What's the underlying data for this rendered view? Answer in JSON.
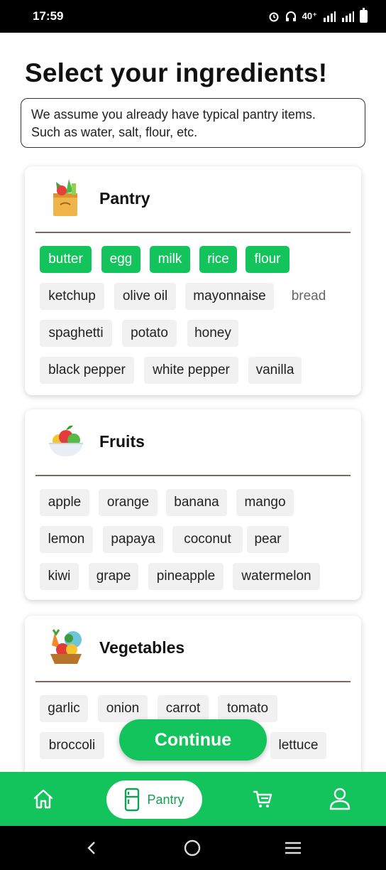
{
  "status_bar": {
    "time": "17:59",
    "indicators": "40⁺"
  },
  "page": {
    "title": "Select your ingredients!",
    "note_line1": "We assume you already have typical pantry items.",
    "note_line2": "Such as water, salt, flour, etc."
  },
  "sections": {
    "pantry": {
      "title": "Pantry",
      "icon": "grocery-bag-icon",
      "items": [
        "butter",
        "egg",
        "milk",
        "rice",
        "flour",
        "ketchup",
        "olive oil",
        "mayonnaise",
        "bread",
        "spaghetti",
        "potato",
        "honey",
        "black pepper",
        "white pepper",
        "vanilla"
      ],
      "selected": [
        "butter",
        "egg",
        "milk",
        "rice",
        "flour"
      ]
    },
    "fruits": {
      "title": "Fruits",
      "icon": "fruit-bowl-icon",
      "items": [
        "apple",
        "orange",
        "banana",
        "mango",
        "lemon",
        "papaya",
        "coconut",
        "pear",
        "kiwi",
        "grape",
        "pineapple",
        "watermelon"
      ]
    },
    "vegetables": {
      "title": "Vegetables",
      "icon": "vegetable-basket-icon",
      "items": [
        "garlic",
        "onion",
        "carrot",
        "tomato",
        "broccoli",
        "lettuce"
      ]
    }
  },
  "continue_label": "Continue",
  "bottom_nav": {
    "home_icon": "home-icon",
    "pantry_label": "Pantry",
    "pantry_icon": "fridge-icon",
    "cart_icon": "cart-icon",
    "profile_icon": "user-icon"
  },
  "colors": {
    "accent": "#13c35c",
    "chip_bg": "#f1f1f1"
  }
}
